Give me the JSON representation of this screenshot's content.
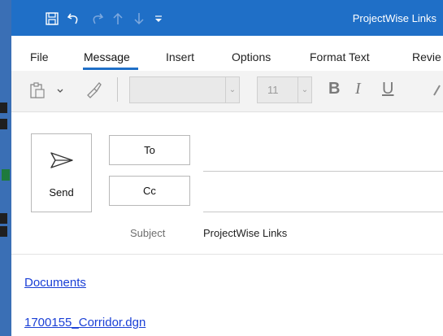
{
  "window": {
    "title": "ProjectWise Links"
  },
  "quick_access": {
    "icons": [
      "save-icon",
      "undo-icon",
      "redo-icon",
      "up-arrow-icon",
      "down-arrow-icon",
      "customize-icon"
    ]
  },
  "ribbon": {
    "tabs": [
      {
        "label": "File",
        "active": false
      },
      {
        "label": "Message",
        "active": true
      },
      {
        "label": "Insert",
        "active": false
      },
      {
        "label": "Options",
        "active": false
      },
      {
        "label": "Format Text",
        "active": false
      },
      {
        "label": "Revie",
        "active": false
      }
    ]
  },
  "toolbar": {
    "font_name": "",
    "font_size": "11",
    "bold": "B",
    "italic": "I",
    "underline": "U"
  },
  "compose": {
    "send_label": "Send",
    "to_label": "To",
    "cc_label": "Cc",
    "to_value": "",
    "cc_value": "",
    "subject_label": "Subject",
    "subject_value": "ProjectWise Links"
  },
  "body": {
    "links": [
      "Documents",
      "1700155_Corridor.dgn"
    ]
  },
  "colors": {
    "titlebar": "#1f6fc7",
    "accent": "#1f6fc7",
    "link": "#1a3fd6"
  }
}
